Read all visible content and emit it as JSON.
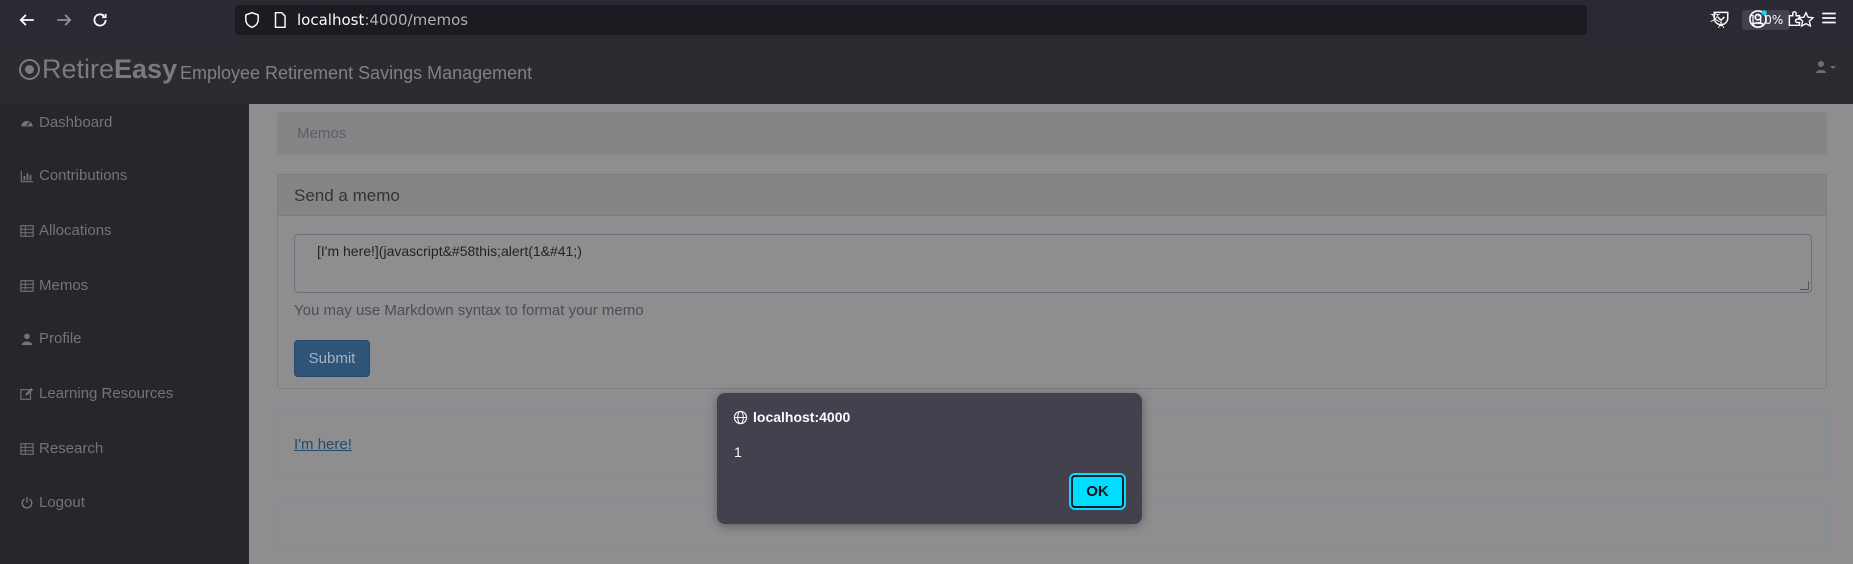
{
  "browser": {
    "url_host": "localhost",
    "url_path": ":4000/memos",
    "zoom": "110%"
  },
  "header": {
    "brand_light": "Retire",
    "brand_bold": "Easy",
    "tagline": "Employee Retirement Savings Management"
  },
  "sidebar": {
    "items": [
      {
        "label": "Dashboard",
        "icon": "dashboard-icon"
      },
      {
        "label": "Contributions",
        "icon": "bar-chart-icon"
      },
      {
        "label": "Allocations",
        "icon": "table-icon"
      },
      {
        "label": "Memos",
        "icon": "table-icon"
      },
      {
        "label": "Profile",
        "icon": "user-icon"
      },
      {
        "label": "Learning Resources",
        "icon": "edit-icon"
      },
      {
        "label": "Research",
        "icon": "table-icon"
      },
      {
        "label": "Logout",
        "icon": "power-icon"
      }
    ]
  },
  "main": {
    "breadcrumb": "Memos",
    "panel_title": "Send a memo",
    "memo_value": "[I'm here!](javascript&#58this;alert(1&#41;)",
    "help_text": "You may use Markdown syntax to format your memo",
    "submit_label": "Submit",
    "memo_link": "I'm here!"
  },
  "dialog": {
    "host": "localhost:4000",
    "message": "1",
    "ok_label": "OK"
  },
  "colors": {
    "accent": "#00ddff",
    "chrome_bg": "#2b2a33"
  }
}
